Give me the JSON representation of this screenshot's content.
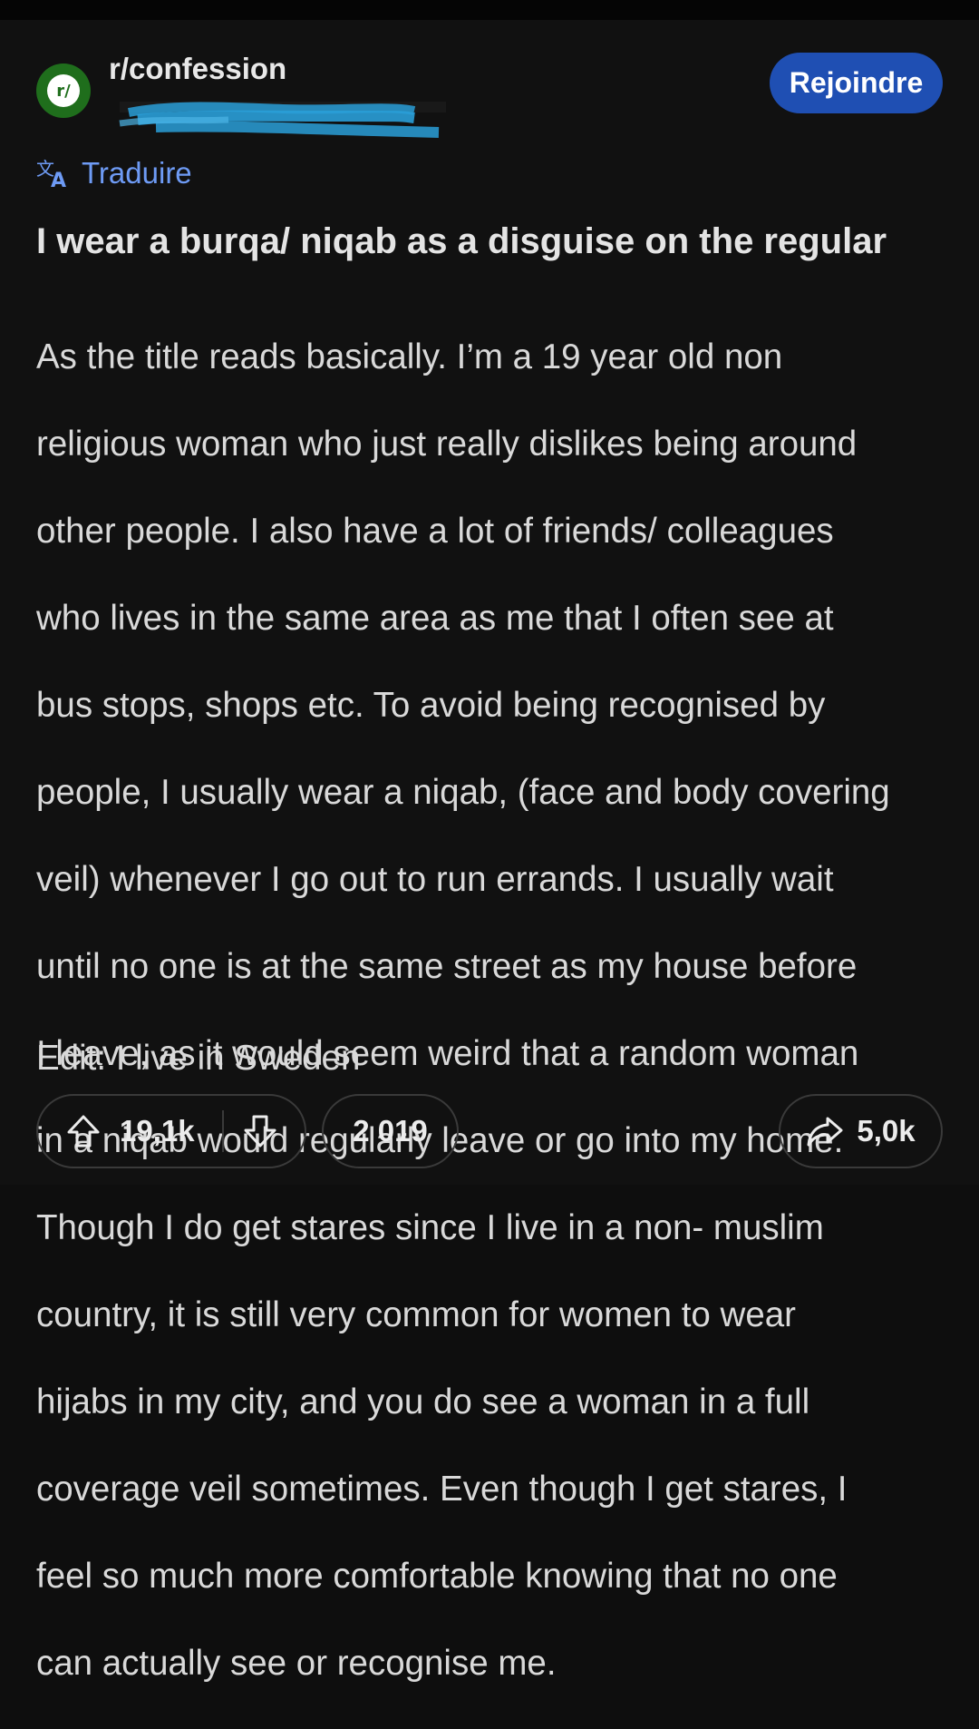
{
  "subreddit": {
    "icon_text": "r/",
    "name": "r/confession",
    "join_label": "Rejoindre"
  },
  "translate": {
    "label": "Traduire"
  },
  "post": {
    "title": "I wear a burqa/ niqab as a disguise on the regular",
    "body_lines": [
      "As the title reads basically. I’m a 19 year old non",
      "religious woman who just really dislikes being around",
      "other people. I also have a lot of friends/ colleagues",
      "who lives in the same area as me that I often see at",
      "bus stops, shops etc. To avoid being recognised by",
      "people, I usually wear a niqab, (face and body covering",
      "veil) whenever I go out to run errands. I usually wait",
      "until no one is at the same street as my house before",
      "I leave, as it would seem weird that a random woman",
      "in a niqab would regularly leave or go into my home.",
      "Though I do get stares since I live in a non- muslim",
      "country, it is still very common for women to wear",
      "hijabs in my city, and you do see a woman in a full",
      "coverage veil sometimes. Even though I get stares, I",
      "feel so much more comfortable knowing that no one",
      "can actually see or recognise me."
    ],
    "edit": "Edit: I live in Sweden"
  },
  "actions": {
    "votes": "19,1k",
    "comments": "2 019",
    "shares": "5,0k"
  },
  "colors": {
    "background": "#111111",
    "join_button": "#1f4fb3",
    "translate_link": "#6e9bf5",
    "subreddit_icon": "#1f6e1c",
    "redaction": "#2a9fd8"
  }
}
